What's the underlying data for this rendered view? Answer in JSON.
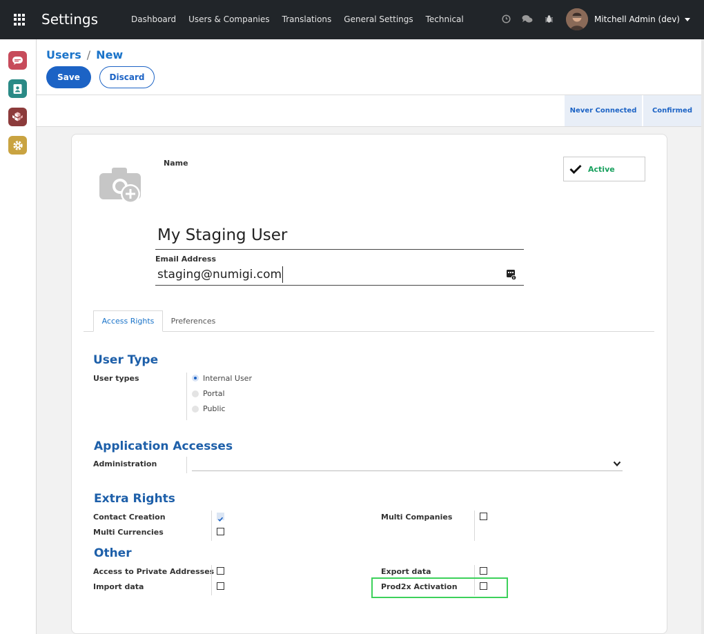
{
  "navbar": {
    "title": "Settings",
    "menu": [
      "Dashboard",
      "Users & Companies",
      "Translations",
      "General Settings",
      "Technical"
    ],
    "tray_icons": [
      "clock-icon",
      "chat-icon",
      "bug-icon"
    ],
    "user_name": "Mitchell Admin (dev)"
  },
  "sidebar": {
    "apps": [
      {
        "icon": "discuss-icon",
        "color": "#c74b5b"
      },
      {
        "icon": "contacts-icon",
        "color": "#2a8a86"
      },
      {
        "icon": "apps-icon",
        "color": "#8c3b3b"
      },
      {
        "icon": "settings-icon",
        "color": "#c9a341"
      }
    ]
  },
  "breadcrumb": {
    "parent": "Users",
    "separator": "/",
    "current": "New"
  },
  "buttons": {
    "save": "Save",
    "discard": "Discard"
  },
  "status_steps": [
    "Never Connected",
    "Confirmed"
  ],
  "form": {
    "name_label": "Name",
    "active_label": "Active",
    "name_value": "My Staging User",
    "email_label": "Email Address",
    "email_value": "staging@numigi.com"
  },
  "tabs": [
    "Access Rights",
    "Preferences"
  ],
  "sections": {
    "user_type": {
      "title": "User Type",
      "label": "User types",
      "options": [
        {
          "label": "Internal User",
          "checked": true
        },
        {
          "label": "Portal",
          "checked": false
        },
        {
          "label": "Public",
          "checked": false
        }
      ]
    },
    "app_access": {
      "title": "Application Accesses",
      "label": "Administration",
      "selected": ""
    },
    "extra_rights": {
      "title": "Extra Rights",
      "contact_creation": {
        "label": "Contact Creation",
        "checked": true
      },
      "multi_currencies": {
        "label": "Multi Currencies",
        "checked": false
      },
      "multi_companies": {
        "label": "Multi Companies",
        "checked": false
      }
    },
    "other": {
      "title": "Other",
      "private_addresses": {
        "label": "Access to Private Addresses",
        "checked": false
      },
      "import_data": {
        "label": "Import data",
        "checked": false
      },
      "export_data": {
        "label": "Export data",
        "checked": false
      },
      "prod2x": {
        "label": "Prod2x Activation",
        "checked": false
      }
    }
  },
  "colors": {
    "navbar_bg": "#212529",
    "primary": "#1c63c5",
    "section_title": "#1d5fa9",
    "active_green": "#17a05d",
    "highlight": "#3cd15a"
  }
}
